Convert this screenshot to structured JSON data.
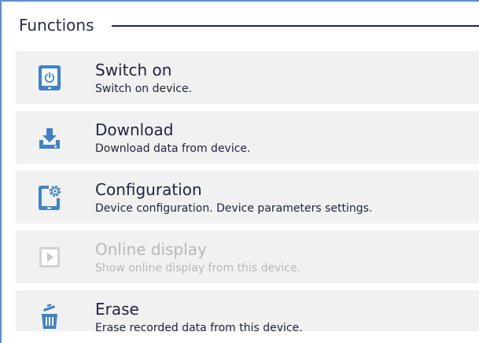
{
  "panel": {
    "title": "Functions"
  },
  "functions": [
    {
      "title": "Switch on",
      "description": "Switch on device.",
      "icon": "power-tablet-icon",
      "enabled": true
    },
    {
      "title": "Download",
      "description": "Download data from device.",
      "icon": "download-icon",
      "enabled": true
    },
    {
      "title": "Configuration",
      "description": "Device configuration. Device parameters settings.",
      "icon": "configuration-tablet-icon",
      "enabled": true
    },
    {
      "title": "Online display",
      "description": "Show online display from this device.",
      "icon": "play-display-icon",
      "enabled": false
    },
    {
      "title": "Erase",
      "description": "Erase recorded data from this device.",
      "icon": "trash-icon",
      "enabled": true
    }
  ],
  "colors": {
    "accent": "#5b8fcf",
    "icon": "#3f83c6",
    "text": "#22263f",
    "disabled": "#b8b8b8",
    "item_background": "#f1f1f1"
  }
}
